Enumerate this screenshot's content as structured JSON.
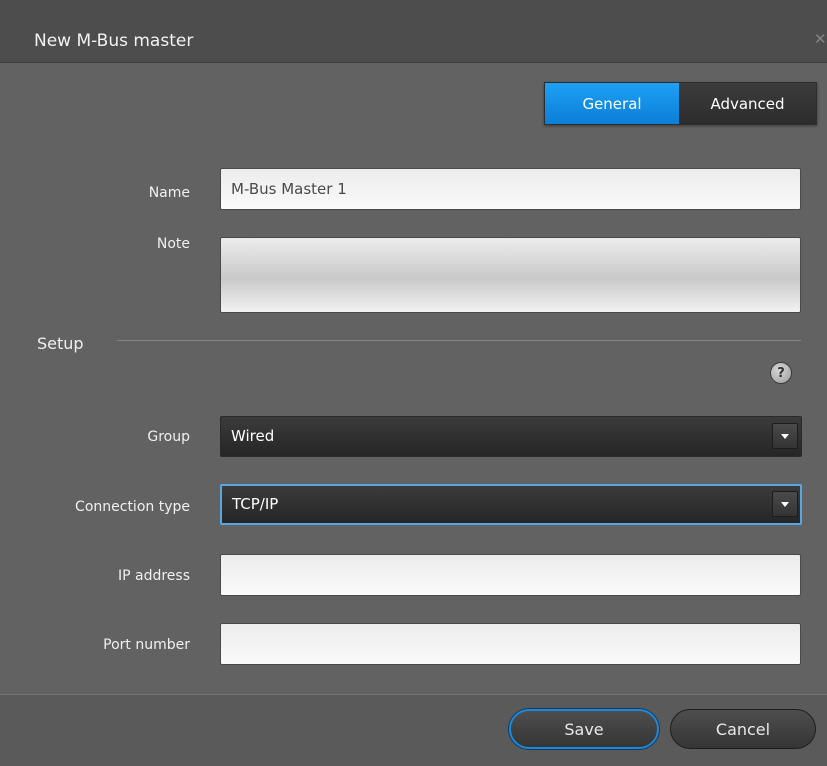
{
  "window": {
    "title": "New M-Bus master"
  },
  "tabs": [
    {
      "label": "General",
      "active": true
    },
    {
      "label": "Advanced",
      "active": false
    }
  ],
  "fields": {
    "name": {
      "label": "Name",
      "value": "M-Bus Master 1"
    },
    "note": {
      "label": "Note",
      "value": ""
    }
  },
  "setup": {
    "section_title": "Setup",
    "help_icon": "?",
    "group": {
      "label": "Group",
      "value": "Wired"
    },
    "connection_type": {
      "label": "Connection type",
      "value": "TCP/IP"
    },
    "ip_address": {
      "label": "IP address",
      "value": ""
    },
    "port_number": {
      "label": "Port number",
      "value": ""
    }
  },
  "footer": {
    "save_label": "Save",
    "cancel_label": "Cancel"
  },
  "icons": {
    "close": "close-icon",
    "help": "help-icon",
    "dropdown": "chevron-down-icon"
  },
  "colors": {
    "accent": "#0b8ae6",
    "focus_border": "#56a8e2",
    "background": "#626262",
    "titlebar": "#4d4d4d"
  }
}
